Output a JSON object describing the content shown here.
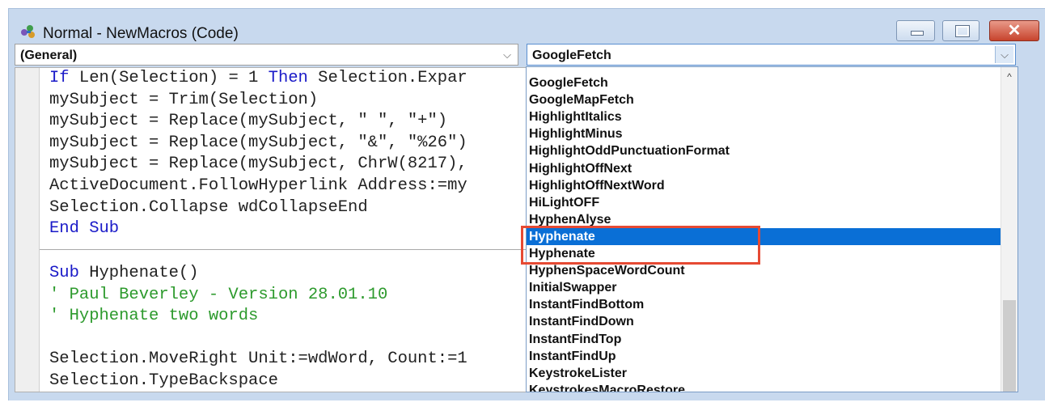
{
  "window": {
    "title": "Normal - NewMacros (Code)",
    "icon": "vba-project-icon",
    "close_glyph": "✕"
  },
  "object_combo": {
    "value": "(General)",
    "arrow": "⌵"
  },
  "procedure_combo": {
    "value": "GoogleFetch",
    "arrow": "⌵"
  },
  "code": {
    "lines_before": [
      [
        {
          "t": "If",
          "k": "kw"
        },
        {
          "t": " Len(Selection) = 1 "
        },
        {
          "t": "Then",
          "k": "kw"
        },
        {
          "t": " Selection.Expar"
        }
      ],
      [
        {
          "t": "mySubject = Trim(Selection)"
        }
      ],
      [
        {
          "t": "mySubject = Replace(mySubject, \" \", \"+\")"
        }
      ],
      [
        {
          "t": "mySubject = Replace(mySubject, \"&\", \"%26\")"
        }
      ],
      [
        {
          "t": "mySubject = Replace(mySubject, ChrW(8217),"
        }
      ],
      [
        {
          "t": "ActiveDocument.FollowHyperlink Address:=my"
        }
      ],
      [
        {
          "t": "Selection.Collapse wdCollapseEnd"
        }
      ],
      [
        {
          "t": "End Sub",
          "k": "kw"
        }
      ]
    ],
    "lines_after": [
      [
        {
          "t": "Sub",
          "k": "kw"
        },
        {
          "t": " Hyphenate()"
        }
      ],
      [
        {
          "t": "' Paul Beverley - Version 28.01.10",
          "k": "cm"
        }
      ],
      [
        {
          "t": "' Hyphenate two words",
          "k": "cm"
        }
      ],
      [
        {
          "t": ""
        }
      ],
      [
        {
          "t": "Selection.MoveRight Unit:=wdWord, Count:=1"
        }
      ],
      [
        {
          "t": "Selection.TypeBackspace"
        }
      ]
    ]
  },
  "dropdown": {
    "items": [
      "GoogleFetch",
      "GoogleMapFetch",
      "HighlightItalics",
      "HighlightMinus",
      "HighlightOddPunctuationFormat",
      "HighlightOffNext",
      "HighlightOffNextWord",
      "HiLightOFF",
      "HyphenAlyse",
      "Hyphenate",
      "Hyphenate",
      "HyphenSpaceWordCount",
      "InitialSwapper",
      "InstantFindBottom",
      "InstantFindDown",
      "InstantFindTop",
      "InstantFindUp",
      "KeystrokeLister",
      "KeystrokesMacroRestore"
    ],
    "selected_index": 9,
    "scroll_up": "^"
  },
  "colors": {
    "keyword": "#1a1ac8",
    "comment": "#2d9a2d",
    "selection": "#0a6fd6",
    "annotation_box": "#e64a33"
  }
}
